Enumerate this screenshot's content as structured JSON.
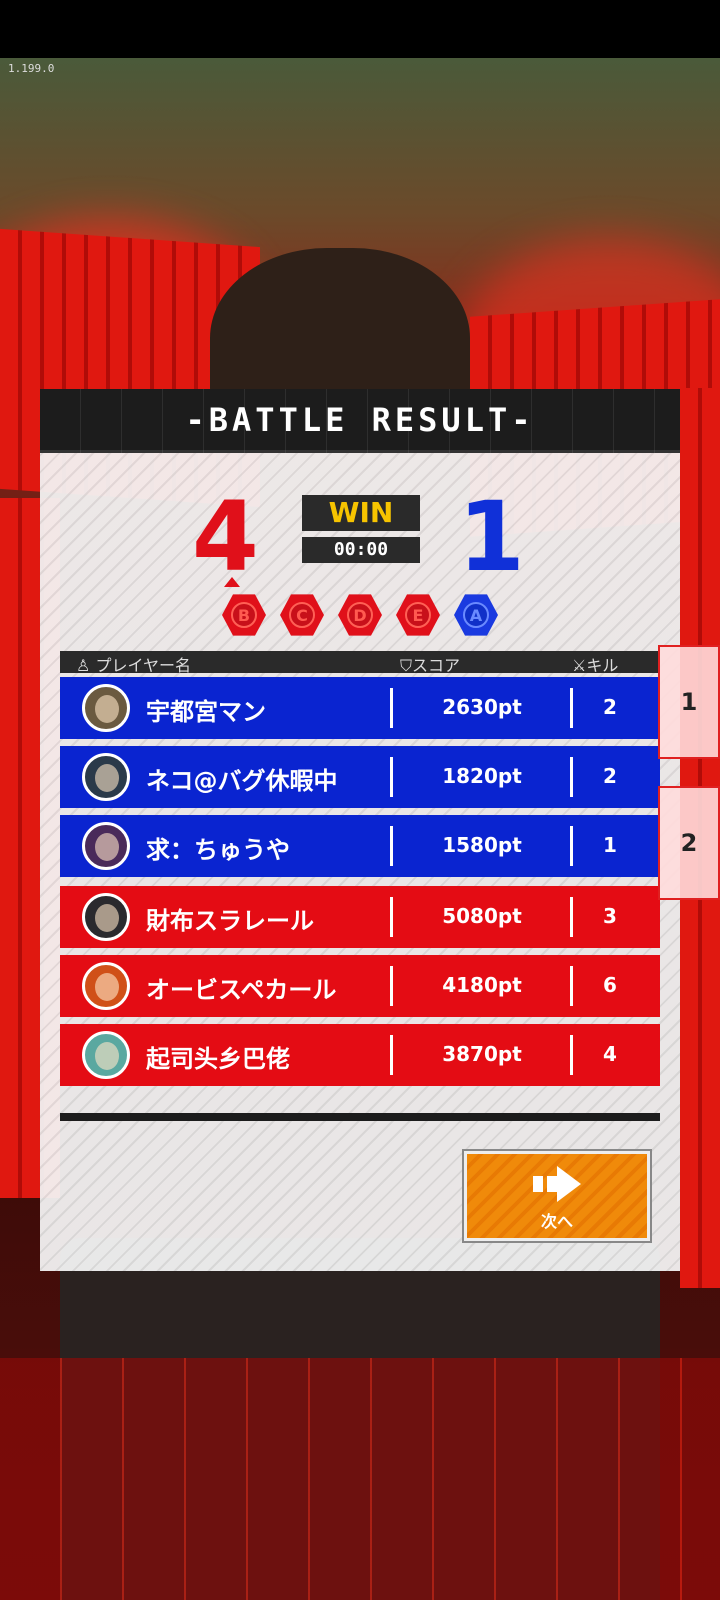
{
  "version": "1.199.0",
  "result": {
    "title": "-BATTLE RESULT-",
    "red_score": "4",
    "blue_score": "1",
    "status": "WIN",
    "timer": "00:00"
  },
  "points": [
    {
      "label": "B",
      "team": "red"
    },
    {
      "label": "C",
      "team": "red"
    },
    {
      "label": "D",
      "team": "red"
    },
    {
      "label": "E",
      "team": "red"
    },
    {
      "label": "A",
      "team": "blue"
    }
  ],
  "columns": {
    "player": "プレイヤー名",
    "score": "スコア",
    "kill": "キル"
  },
  "players": [
    {
      "name": "宇都宮マン",
      "score": "2630pt",
      "kills": "2",
      "team": "blue"
    },
    {
      "name": "ネコ@バグ休暇中",
      "score": "1820pt",
      "kills": "2",
      "team": "blue"
    },
    {
      "name": "求：ちゅうや",
      "score": "1580pt",
      "kills": "1",
      "team": "blue"
    },
    {
      "name": "財布スラレール",
      "score": "5080pt",
      "kills": "3",
      "team": "red"
    },
    {
      "name": "オービスペカール",
      "score": "4180pt",
      "kills": "6",
      "team": "red"
    },
    {
      "name": "起司头乡巴佬",
      "score": "3870pt",
      "kills": "4",
      "team": "red"
    }
  ],
  "next_button": {
    "label": "次へ"
  },
  "side_tabs": [
    "1",
    "2"
  ],
  "colors": {
    "red_team": "#e40c14",
    "blue_team": "#0a24d0",
    "win_text": "#f7c400",
    "next_button": "#f08a0a"
  }
}
